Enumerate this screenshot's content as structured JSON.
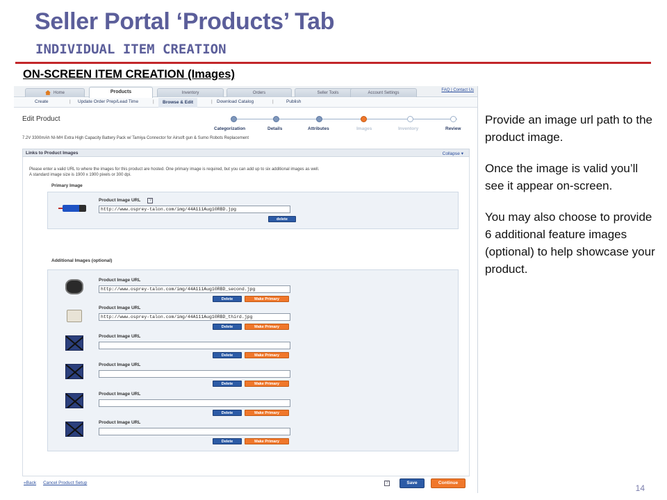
{
  "slide": {
    "title": "Seller Portal ‘Products’ Tab",
    "subtitle": "INDIVIDUAL ITEM CREATION",
    "section_heading": "ON-SCREEN ITEM CREATION (Images)",
    "page_number": "14",
    "accent_color": "#c2262a",
    "title_color": "#5b5e9a"
  },
  "notes": [
    "Provide an image url path to the product image.",
    "Once the image is valid you’ll see it appear on-screen.",
    "You may also choose to provide 6 additional feature images (optional) to help showcase your product."
  ],
  "screenshot": {
    "tabs": [
      "Home",
      "Products",
      "Inventory",
      "Orders",
      "Seller Tools",
      "Account Settings"
    ],
    "active_tab": "Products",
    "top_links": "FAQ | Contact Us",
    "subnav": [
      "Create",
      "Update Order Prep/Lead Time",
      "Browse & Edit",
      "Download Catalog",
      "Publish"
    ],
    "subnav_separator": "|",
    "edit_title": "Edit Product",
    "steps": [
      "Categorization",
      "Details",
      "Attributes",
      "Images",
      "Inventory",
      "Review"
    ],
    "current_step": "Images",
    "product_description": "7.2V 3300mAh NI-MH Extra High Capacity Battery Pack w/ Tamiya Connector for Airsoft gun & Sumo Robots Replacement",
    "panel_title": "Links to Product Images",
    "collapse_label": "Collapse ▾",
    "intro_line1": "Please enter a valid URL to where the images for this product are hosted. One primary image is required, but you can add up to six additional images as well.",
    "intro_line2": "A standard image size is 1900 x 1900 pixels or 300 dpi.",
    "primary_label": "Primary Image",
    "additional_label": "Additional Images (optional)",
    "url_field_label": "Product Image URL",
    "help_glyph": "?",
    "delete_label": "delete",
    "delete_label_caps": "Delete",
    "make_primary_label": "Make Primary",
    "primary_url": "http://www.osprey-talon.com/img/44A111Aug10RBD.jpg",
    "additional_urls": [
      "http://www.osprey-talon.com/img/44A111Aug10RBD_second.jpg",
      "http://www.osprey-talon.com/img/44A111Aug10RBD_third.jpg",
      "",
      "",
      "",
      ""
    ],
    "back_link": "«Back",
    "cancel_link": "Cancel Product Setup",
    "save_label": "Save",
    "continue_label": "Continue"
  }
}
